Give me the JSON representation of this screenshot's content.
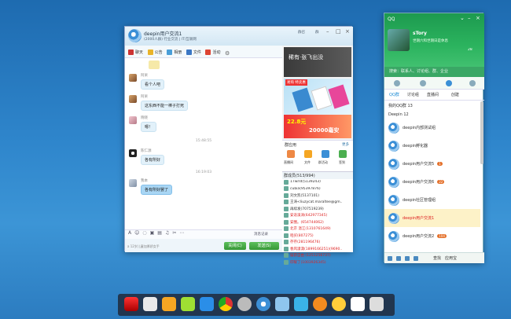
{
  "chat": {
    "title": "deepin用户交流1",
    "subtitle": "(2000人群) 行业交流 | IT/互联网",
    "top_btns": [
      "群召",
      "群"
    ],
    "toolbar": [
      "聊天",
      "公告",
      "相册",
      "文件",
      "活动"
    ],
    "messages": [
      {
        "name": "阿呆",
        "text": "看个人吧"
      },
      {
        "name": "阿呆",
        "text": "这东西不能一棒子打死"
      },
      {
        "name": "晓晓",
        "text": "嗯！"
      },
      {
        "time": "15:48:55"
      },
      {
        "name": "陈仁源",
        "text": "各有所好"
      },
      {
        "time": "16:19:03"
      },
      {
        "name": "我本",
        "text": "各有所好罢了",
        "me": true
      }
    ],
    "input_footer": "a 12岁儿童加厚娇女手",
    "msg_record": "消息记录",
    "close_btn": "关闭(C)",
    "send_btn": "发送(S)",
    "ad1_text": "稀有·张飞出没",
    "ad_sub": "易购 特卖惠",
    "ad_price": "22.8元",
    "ad_cap": "20000毫安",
    "apps_title": "群应用",
    "apps_more": "更多",
    "apps": [
      "直播间",
      "文件",
      "群活动",
      "签到"
    ],
    "members_title": "群成员(513/994)",
    "members": [
      "17wrld(5139243)",
      "cubia(95397876)",
      "刘文凯(5137101)",
      "王涛<liuzycat.maraltee@gm..",
      "再续发(707519239)",
      "安迭溪涛(642977345)",
      "安圈。(654744062)",
      "北京 温江(1310761649)",
      "咱买(807275)",
      "存存(281196476)",
      "春风潇潇(1899166251)(9690..",
      "届获自由 (1251256737)",
      "印暖了(1003926345)"
    ]
  },
  "qq": {
    "title": "QQ",
    "nick": "sTory",
    "sign": "世期六和世期日是休息",
    "status": "28",
    "search_ph": "搜索：联系人、讨论组、群、企业",
    "tabs": [
      "QQ群",
      "讨论组",
      "直播间",
      "创建"
    ],
    "groups": [
      {
        "label": "我的QQ群 13"
      },
      {
        "label": "Deepin 12"
      }
    ],
    "items": [
      {
        "name": "deepin内部测试组",
        "badge": ""
      },
      {
        "name": "deepin孵化器",
        "badge": ""
      },
      {
        "name": "deepin用户交流5",
        "badge": "1"
      },
      {
        "name": "deepin用户交流6",
        "badge": "22"
      },
      {
        "name": "deepin社区管理组",
        "badge": ""
      },
      {
        "name": "deepin用户交流1",
        "badge": "",
        "active": true
      },
      {
        "name": "deepin用户交流2",
        "badge": "104"
      }
    ],
    "foot_search": "查找",
    "foot_app": "应用宝"
  },
  "colors": {
    "qq_green": "#2bb35e",
    "badge": "#e4702a",
    "send_green": "#3aa53a"
  }
}
